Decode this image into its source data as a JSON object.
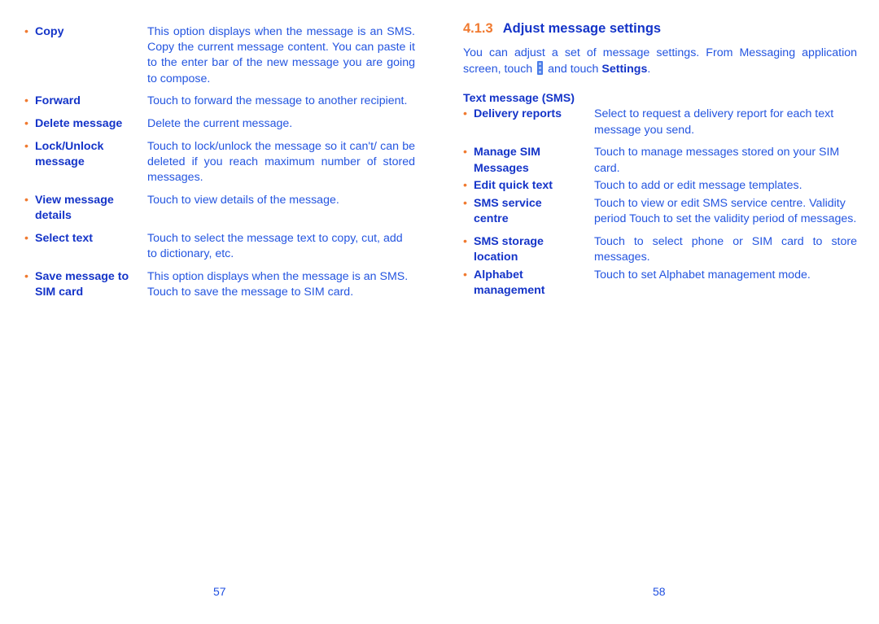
{
  "left_page": {
    "items": [
      {
        "term": "Copy",
        "desc": "This option displays when the message is an SMS. Copy the current message content. You can paste it to the enter bar of the new message you are going to compose."
      },
      {
        "term": "Forward",
        "desc": "Touch to forward the message to another recipient."
      },
      {
        "term": "Delete message",
        "desc": "Delete the current message."
      },
      {
        "term": "Lock/Unlock message",
        "desc": "Touch to lock/unlock the message so it can't/ can be deleted if you reach maximum number of stored messages."
      },
      {
        "term": "View message details",
        "desc": "Touch to view details of the message."
      },
      {
        "term": "Select text",
        "desc": "Touch to select the message text to copy, cut, add to dictionary, etc."
      },
      {
        "term": "Save message to SIM card",
        "desc": "This option displays when the message is an SMS. Touch to save the message to SIM card."
      }
    ],
    "page_number": "57"
  },
  "right_page": {
    "heading_number": "4.1.3",
    "heading_title": "Adjust message settings",
    "intro_before_icon": "You can adjust a set of message settings. From Messaging application screen, touch",
    "intro_icon": "menu-icon",
    "intro_after_icon": "and touch",
    "intro_bold": "Settings",
    "intro_end": ".",
    "subheading": "Text message (SMS)",
    "items": [
      {
        "term": "Delivery reports",
        "desc": "Select to request a delivery report for each text message you send."
      },
      {
        "term": "Manage SIM Messages",
        "desc": "Touch to manage messages stored on your SIM card."
      },
      {
        "term": "Edit quick text",
        "desc": "Touch to add or edit message templates."
      },
      {
        "term": "SMS service centre",
        "desc": "Touch to view or edit SMS service centre. Validity period Touch to set the validity period of messages."
      },
      {
        "term": "SMS storage location",
        "desc": "Touch to select phone or SIM card to store messages."
      },
      {
        "term": "Alphabet management",
        "desc": "Touch to set Alphabet management mode."
      }
    ],
    "page_number": "58"
  },
  "colors": {
    "text": "#2455e0",
    "term": "#1434c8",
    "bullet": "#f07a30"
  }
}
